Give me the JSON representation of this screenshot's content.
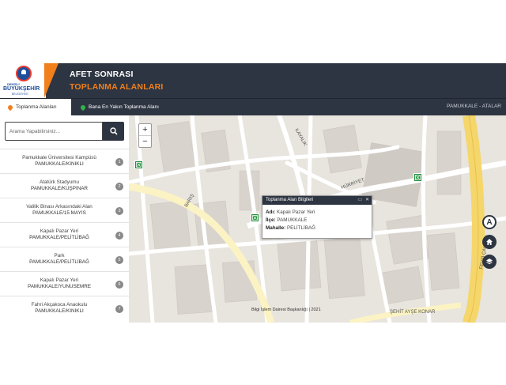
{
  "header": {
    "logo": {
      "line1": "DENİZLİ",
      "line2": "BÜYÜKŞEHİR",
      "line3": "BELEDİYESİ"
    },
    "title_line1": "AFET SONRASI",
    "title_line2": "TOPLANMA ALANLARI"
  },
  "tabs": [
    {
      "label": "Toplanma Alanları",
      "icon": "map-pin-icon",
      "color": "#f07f1c"
    },
    {
      "label": "Bana En Yakın Toplanma Alanı",
      "icon": "map-pin-icon",
      "color": "#2fb34a"
    }
  ],
  "location": "PAMUKKALE - ATALAR",
  "search": {
    "placeholder": "Arama Yapabilirsiniz..."
  },
  "list": [
    {
      "name": "Pamukkale Üniversitesi Kampüsü",
      "loc": "PAMUKKALE/KINIKLI",
      "num": "1"
    },
    {
      "name": "Atatürk Stadyumu",
      "loc": "PAMUKKALE/KUŞPINAR",
      "num": "2"
    },
    {
      "name": "Valilik Binası Arkasındaki Alan",
      "loc": "PAMUKKALE/15 MAYIS",
      "num": "3"
    },
    {
      "name": "Kapalı Pazar Yeri",
      "loc": "PAMUKKALE/PELİTLİBAĞ",
      "num": "4"
    },
    {
      "name": "Park",
      "loc": "PAMUKKALE/PELİTLİBAĞ",
      "num": "5"
    },
    {
      "name": "Kapalı Pazar Yeri",
      "loc": "PAMUKKALE/YUNUSEMRE",
      "num": "6"
    },
    {
      "name": "Fahri Akçakoca Anaokulu",
      "loc": "PAMUKKALE/KINIKLI",
      "num": "7"
    }
  ],
  "map": {
    "zoom_in": "+",
    "zoom_out": "−",
    "popup": {
      "title": "Toplanma Alan Bilgileri",
      "rows": [
        {
          "label": "Adı:",
          "value": "Kapalı Pazar Yeri"
        },
        {
          "label": "İlçe:",
          "value": "PAMUKKALE"
        },
        {
          "label": "Mahalle:",
          "value": "PELİTLİBAĞ"
        }
      ]
    },
    "streets": [
      "BARIŞ",
      "KAYALIK",
      "HÜRRİYET",
      "FEVZİ ÇAKMAK",
      "ŞEHİT AYŞE KONAR"
    ],
    "attribution": "Bilgi İşlem Dairesi Başkanlığı | 2021",
    "compass_label": "A"
  },
  "colors": {
    "header_bg": "#2e3542",
    "accent": "#f07f1c",
    "marker": "#1e8f3a",
    "road_major": "#f5d66b"
  }
}
